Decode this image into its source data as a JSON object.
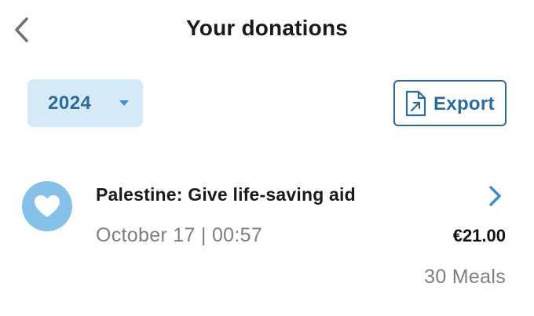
{
  "header": {
    "title": "Your donations",
    "back_icon": "chevron-left-icon"
  },
  "filters": {
    "year": {
      "selected": "2024",
      "caret_icon": "caret-down-icon"
    },
    "export": {
      "label": "Export",
      "icon": "document-export-icon"
    }
  },
  "donations": [
    {
      "title": "Palestine: Give life-saving aid",
      "date": "October 17 | 00:57",
      "amount": "€21.00",
      "meals": "30 Meals",
      "icon": "heart-icon",
      "chevron_icon": "chevron-right-icon"
    }
  ],
  "colors": {
    "accent": "#2d6a9c",
    "accent_light": "#d6e9f7",
    "avatar": "#86c1e9",
    "chevron": "#3b8fd0",
    "muted_text": "#7a7f86"
  }
}
